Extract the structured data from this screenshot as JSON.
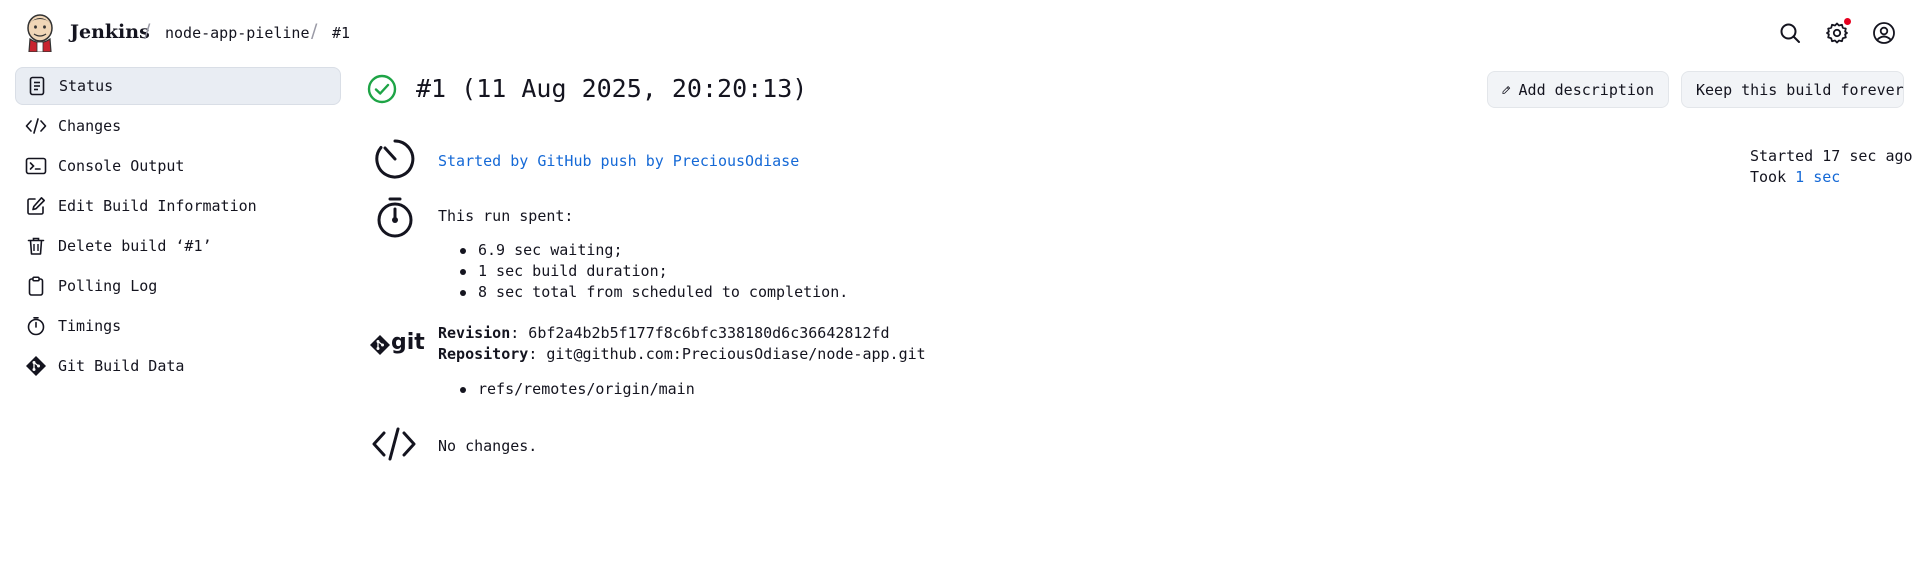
{
  "header": {
    "brand": "Jenkins",
    "breadcrumbs": [
      "node-app-pieline",
      "#1"
    ],
    "separator": "/",
    "icons": [
      "search-icon",
      "settings-icon",
      "account-icon"
    ],
    "notification_color": "#e6001f"
  },
  "sidebar": {
    "items": [
      {
        "label": "Status",
        "icon": "status-icon",
        "active": true
      },
      {
        "label": "Changes",
        "icon": "code-icon"
      },
      {
        "label": "Console Output",
        "icon": "terminal-icon"
      },
      {
        "label": "Edit Build Information",
        "icon": "edit-icon"
      },
      {
        "label": "Delete build ‘#1’",
        "icon": "trash-icon"
      },
      {
        "label": "Polling Log",
        "icon": "clipboard-icon"
      },
      {
        "label": "Timings",
        "icon": "stopwatch-icon"
      },
      {
        "label": "Git Build Data",
        "icon": "git-icon"
      }
    ]
  },
  "main": {
    "title": "#1 (11 Aug 2025, 20:20:13)",
    "status_color": "#1ea446",
    "buttons": {
      "add_description": "Add description",
      "keep_forever": "Keep this build forever"
    },
    "started_by": "Started by GitHub push by PreciousOdiase",
    "summary": {
      "started": "Started 17 sec ago",
      "took_prefix": "Took",
      "took_link": "1 sec"
    },
    "run_spent": {
      "heading": "This run spent:",
      "items": [
        "6.9 sec waiting;",
        "1 sec build duration;",
        "8 sec total from scheduled to completion."
      ]
    },
    "git": {
      "word": "git",
      "revision_label": "Revision",
      "revision_value": ": 6bf2a4b2b5f177f8c6bfc338180d6c36642812fd",
      "repository_label": "Repository",
      "repository_value": ": git@github.com:PreciousOdiase/node-app.git",
      "refs": [
        "refs/remotes/origin/main"
      ]
    },
    "changes": "No changes."
  }
}
